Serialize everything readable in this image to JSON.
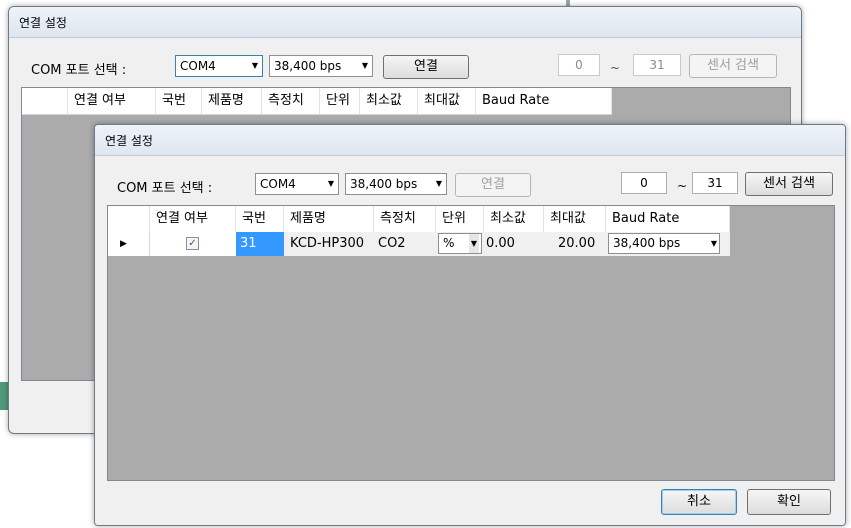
{
  "back_dialog": {
    "title": "연결 설정",
    "port_label": "COM 포트 선택 :",
    "port_value": "COM4",
    "baud_value": "38,400 bps",
    "connect_label": "연결",
    "range_from": "0",
    "range_to": "31",
    "range_sep": "~",
    "search_label": "센서 검색",
    "columns": [
      "연결 여부",
      "국번",
      "제품명",
      "측정치",
      "단위",
      "최소값",
      "최대값",
      "Baud Rate"
    ]
  },
  "front_dialog": {
    "title": "연결 설정",
    "port_label": "COM 포트 선택 :",
    "port_value": "COM4",
    "baud_value": "38,400 bps",
    "connect_label": "연결",
    "range_from": "0",
    "range_to": "31",
    "range_sep": "~",
    "search_label": "센서 검색",
    "columns": [
      "연결 여부",
      "국번",
      "제품명",
      "측정치",
      "단위",
      "최소값",
      "최대값",
      "Baud Rate"
    ],
    "row": {
      "station": "31",
      "product": "KCD-HP300",
      "measurement": "CO2",
      "unit": "%",
      "min": "0.00",
      "max": "20.00",
      "baud": "38,400 bps",
      "checked": true
    },
    "cancel_label": "취소",
    "ok_label": "확인"
  },
  "icons": {
    "dropdown": "chevron-down-icon",
    "row_pointer": "row-pointer-icon",
    "checkbox": "checkbox-checked-icon"
  }
}
